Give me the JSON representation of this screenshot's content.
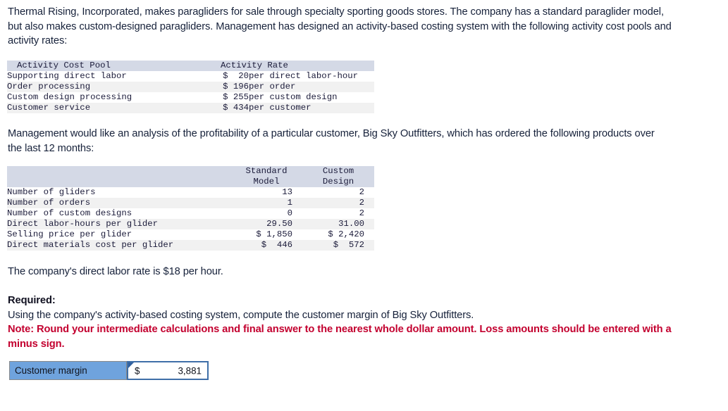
{
  "intro": {
    "paragraph": "Thermal Rising, Incorporated, makes paragliders for sale through specialty sporting goods stores. The company has a standard paraglider model, but also makes custom-designed paragliders. Management has designed an activity-based costing system with the following activity cost pools and activity rates:"
  },
  "activity_rate_table": {
    "headers": {
      "pool": "Activity Cost Pool",
      "rate": "Activity Rate"
    },
    "rows": [
      {
        "pool": "Supporting direct labor",
        "rate": "$  20",
        "basis": "per direct labor-hour"
      },
      {
        "pool": "Order processing",
        "rate": "$ 196",
        "basis": "per order"
      },
      {
        "pool": "Custom design processing",
        "rate": "$ 255",
        "basis": "per custom design"
      },
      {
        "pool": "Customer service",
        "rate": "$ 434",
        "basis": "per customer"
      }
    ]
  },
  "analysis": {
    "paragraph": "Management would like an analysis of the profitability of a particular customer, Big Sky Outfitters, which has ordered the following products over the last 12 months:"
  },
  "product_data_table": {
    "headers": {
      "blank": "",
      "standard_line1": "Standard",
      "standard_line2": "Model",
      "custom_line1": "Custom",
      "custom_line2": "Design"
    },
    "rows": [
      {
        "item": "Number of gliders",
        "standard": "13",
        "custom": "2"
      },
      {
        "item": "Number of orders",
        "standard": "1",
        "custom": "2"
      },
      {
        "item": "Number of custom designs",
        "standard": "0",
        "custom": "2"
      },
      {
        "item": "Direct labor-hours per glider",
        "standard": "29.50",
        "custom": "31.00"
      },
      {
        "item": "Selling price per glider",
        "standard": "$ 1,850",
        "custom": "$ 2,420"
      },
      {
        "item": "Direct materials cost per glider",
        "standard": "$  446",
        "custom": "$  572"
      }
    ]
  },
  "labor_rate": {
    "paragraph": "The company's direct labor rate is $18 per hour."
  },
  "required": {
    "label": "Required:",
    "text": "Using the company's activity-based costing system, compute the customer margin of Big Sky Outfitters.",
    "note": "Note: Round your intermediate calculations and final answer to the nearest whole dollar amount. Loss amounts should be entered with a minus sign."
  },
  "answer": {
    "label": "Customer margin",
    "currency": "$",
    "value": "3,881",
    "marker_icon": "cell-flag-marker"
  },
  "colors": {
    "table_header_bg": "#d4d9e6",
    "table_alt_row_bg": "#f1f1f1",
    "answer_label_bg": "#6fa3dd",
    "answer_border": "#3f6fa8",
    "note_red": "#c3002f",
    "body_text": "#16213a"
  }
}
